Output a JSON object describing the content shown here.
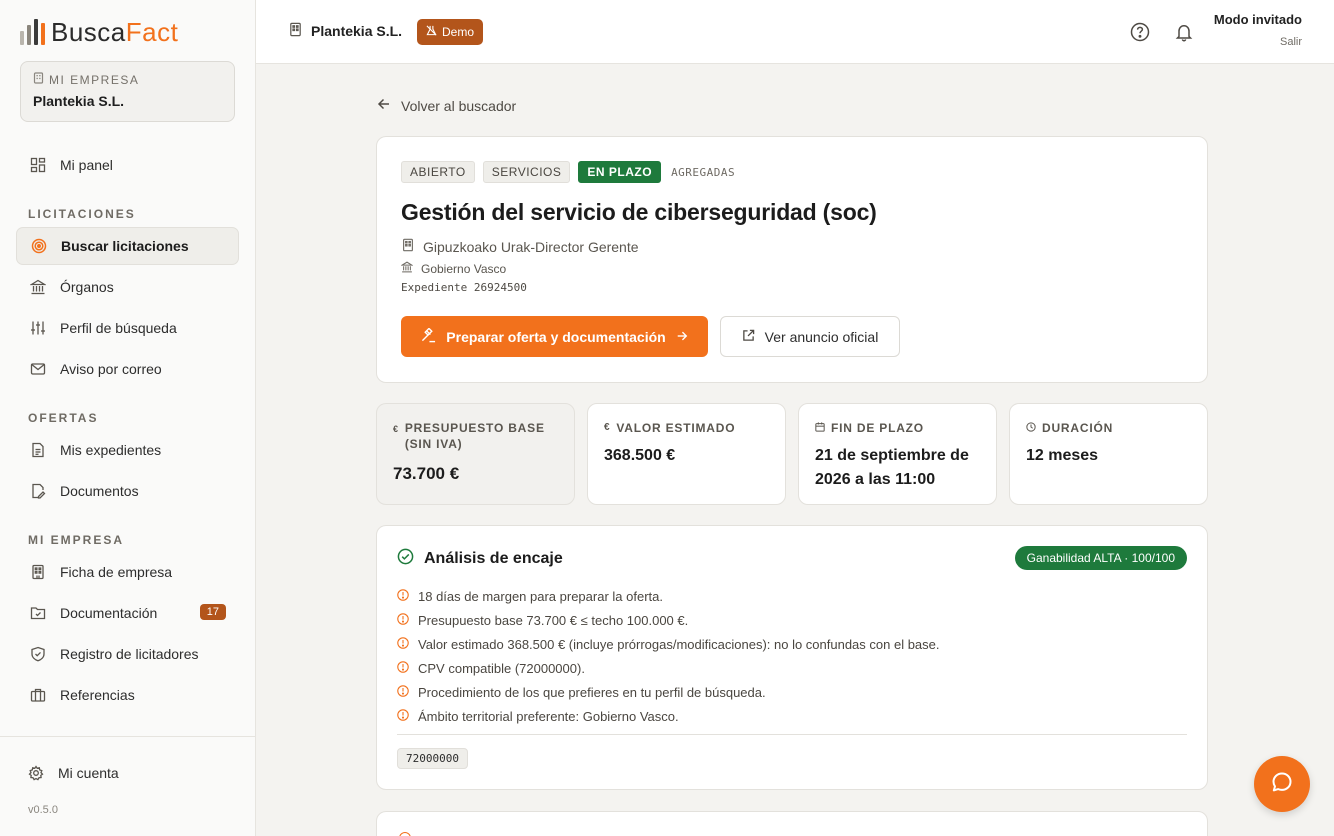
{
  "app": {
    "logo_part1": "Busca",
    "logo_part2": "Fact",
    "version": "v0.5.0",
    "accent_color": "#f2711c",
    "success_color": "#1e7a3c",
    "badge_color": "#b3551b"
  },
  "sidebar": {
    "company_label": "MI EMPRESA",
    "company_name": "Plantekia S.L.",
    "panel": {
      "label": "Mi panel",
      "icon": "dashboard-icon"
    },
    "sections": [
      {
        "title": "LICITACIONES",
        "items": [
          {
            "label": "Buscar licitaciones",
            "icon": "target-icon",
            "active": true
          },
          {
            "label": "Órganos",
            "icon": "bank-icon"
          },
          {
            "label": "Perfil de búsqueda",
            "icon": "sliders-icon"
          },
          {
            "label": "Aviso por correo",
            "icon": "mail-icon"
          }
        ]
      },
      {
        "title": "OFERTAS",
        "items": [
          {
            "label": "Mis expedientes",
            "icon": "file-icon"
          },
          {
            "label": "Documentos",
            "icon": "edit-file-icon"
          }
        ]
      },
      {
        "title": "MI EMPRESA",
        "items": [
          {
            "label": "Ficha de empresa",
            "icon": "building-icon"
          },
          {
            "label": "Documentación",
            "icon": "folder-icon",
            "badge": "17"
          },
          {
            "label": "Registro de licitadores",
            "icon": "shield-icon"
          },
          {
            "label": "Referencias",
            "icon": "briefcase-icon"
          }
        ]
      }
    ],
    "account": {
      "label": "Mi cuenta",
      "icon": "gear-icon"
    }
  },
  "topbar": {
    "company": "Plantekia S.L.",
    "demo_label": "Demo",
    "guest_name": "Modo invitado",
    "logout_label": "Salir"
  },
  "detail": {
    "back_label": "Volver al buscador",
    "tags": [
      "ABIERTO",
      "SERVICIOS",
      "EN PLAZO",
      "AGREGADAS"
    ],
    "title": "Gestión del servicio de ciberseguridad (soc)",
    "organ": "Gipuzkoako Urak-Director Gerente",
    "government": "Gobierno Vasco",
    "expediente": "Expediente 26924500",
    "primary_button": "Preparar oferta y documentación",
    "secondary_button": "Ver anuncio oficial"
  },
  "stats": [
    {
      "label": "PRESUPUESTO BASE (SIN IVA)",
      "value": "73.700 €",
      "icon": "euro-icon"
    },
    {
      "label": "VALOR ESTIMADO",
      "value": "368.500 €",
      "icon": "euro-icon"
    },
    {
      "label": "FIN DE PLAZO",
      "value": "21 de septiembre de 2026 a las 11:00",
      "icon": "calendar-icon"
    },
    {
      "label": "DURACIÓN",
      "value": "12 meses",
      "icon": "clock-icon"
    }
  ],
  "analysis": {
    "title": "Análisis de encaje",
    "score": "Ganabilidad ALTA · 100/100",
    "reasons": [
      "18 días de margen para preparar la oferta.",
      "Presupuesto base 73.700 € ≤ techo 100.000 €.",
      "Valor estimado 368.500 € (incluye prórrogas/modificaciones): no lo confundas con el base.",
      "CPV compatible (72000000).",
      "Procedimiento de los que prefieres en tu perfil de búsqueda.",
      "Ámbito territorial preferente: Gobierno Vasco."
    ],
    "cpv": "72000000"
  }
}
